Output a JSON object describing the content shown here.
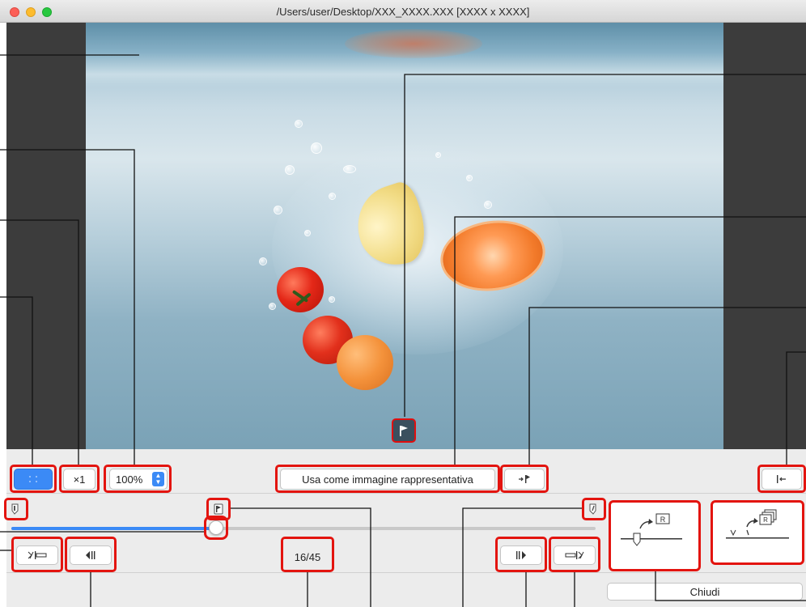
{
  "window": {
    "title": "/Users/user/Desktop/XXX_XXXX.XXX [XXXX x XXXX]"
  },
  "toolbar": {
    "fit_icon": "fit-screen-icon",
    "actual_size_label": "×1",
    "zoom_value": "100%",
    "set_representative_label": "Usa come immagine rappresentativa",
    "goto_representative_icon": "goto-flag-icon",
    "goto_start_icon": "goto-start-icon"
  },
  "timeline": {
    "frame_counter": "16/45",
    "progress_fraction": 0.35,
    "start_marker_icon": "start-marker-icon",
    "flag_marker_icon": "representative-flag-icon",
    "end_marker_icon": "end-marker-icon"
  },
  "playback": {
    "set_start_icon": "set-start-icon",
    "prev_frame_icon": "prev-frame-icon",
    "next_frame_icon": "next-frame-icon",
    "set_end_icon": "set-end-icon"
  },
  "save_panels": {
    "single_badge": "R",
    "multi_badge": "R"
  },
  "footer": {
    "close_label": "Chiudi"
  },
  "colors": {
    "accent_blue": "#3b8af6",
    "callout_red": "#e3140f"
  }
}
